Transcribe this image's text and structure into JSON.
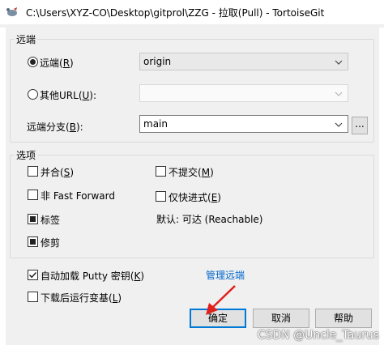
{
  "window": {
    "title": "C:\\Users\\XYZ-CO\\Desktop\\gitprol\\ZZG - 拉取(Pull) - TortoiseGit"
  },
  "remote_group": {
    "legend": "远端",
    "remote_radio": {
      "label": "远端",
      "accel": "R",
      "checked": true
    },
    "remote_combo_value": "origin",
    "other_url_radio": {
      "label": "其他URL",
      "accel": "U",
      "checked": false
    },
    "other_url_value": "",
    "branch_label": "远端分支",
    "branch_accel": "B",
    "branch_value": "main",
    "browse_button": "..."
  },
  "options_group": {
    "legend": "选项",
    "merge": {
      "label": "并合",
      "accel": "S",
      "checked": false
    },
    "no_commit": {
      "label": "不提交",
      "accel": "M",
      "checked": false
    },
    "no_ff": {
      "label": "非 Fast Forward",
      "checked": false
    },
    "ff_only": {
      "label": "仅快进式",
      "accel": "E",
      "checked": false
    },
    "tags": {
      "label": "标签",
      "state": "indeterminate"
    },
    "default_label": "默认: 可达 (Reachable)",
    "prune": {
      "label": "修剪",
      "state": "indeterminate"
    }
  },
  "autoload_putty": {
    "label": "自动加载 Putty 密钥",
    "accel": "K",
    "checked": true
  },
  "manage_remotes_link": "管理远端",
  "launch_rebase": {
    "label": "下载后运行变基",
    "accel": "L",
    "checked": false
  },
  "buttons": {
    "ok": "确定",
    "cancel": "取消",
    "help": "帮助"
  },
  "watermark": "CSDN @Uncle_Taurus",
  "colors": {
    "link": "#0066cc",
    "default_button_border": "#0078d7",
    "annotation_arrow": "#e0201c"
  }
}
